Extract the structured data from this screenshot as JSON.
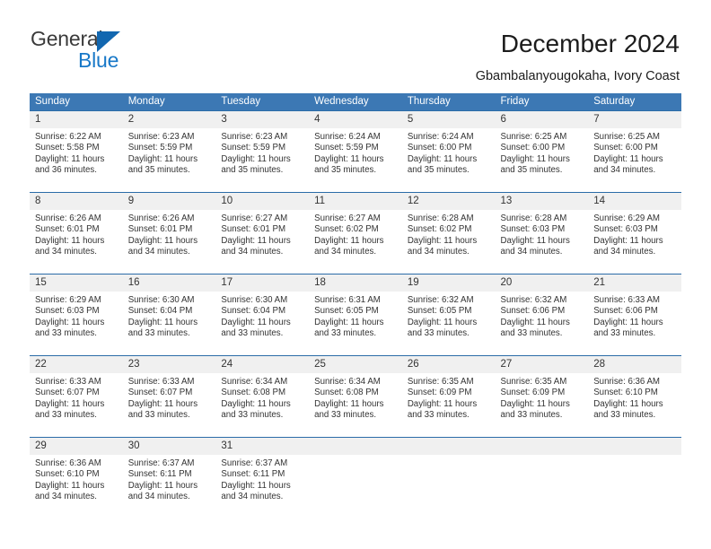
{
  "brand": {
    "name_part1": "General",
    "name_part2": "Blue"
  },
  "header": {
    "title": "December 2024",
    "subtitle": "Gbambalanyougokaha, Ivory Coast"
  },
  "colors": {
    "header_blue": "#3c78b4",
    "week_rule": "#2b6ca8",
    "date_band": "#f0f0f0",
    "brand_blue": "#1878c8",
    "text": "#333333"
  },
  "weekdays": [
    "Sunday",
    "Monday",
    "Tuesday",
    "Wednesday",
    "Thursday",
    "Friday",
    "Saturday"
  ],
  "weeks": [
    {
      "dates": [
        "1",
        "2",
        "3",
        "4",
        "5",
        "6",
        "7"
      ],
      "cells": [
        {
          "sunrise": "Sunrise: 6:22 AM",
          "sunset": "Sunset: 5:58 PM",
          "daylight1": "Daylight: 11 hours",
          "daylight2": "and 36 minutes."
        },
        {
          "sunrise": "Sunrise: 6:23 AM",
          "sunset": "Sunset: 5:59 PM",
          "daylight1": "Daylight: 11 hours",
          "daylight2": "and 35 minutes."
        },
        {
          "sunrise": "Sunrise: 6:23 AM",
          "sunset": "Sunset: 5:59 PM",
          "daylight1": "Daylight: 11 hours",
          "daylight2": "and 35 minutes."
        },
        {
          "sunrise": "Sunrise: 6:24 AM",
          "sunset": "Sunset: 5:59 PM",
          "daylight1": "Daylight: 11 hours",
          "daylight2": "and 35 minutes."
        },
        {
          "sunrise": "Sunrise: 6:24 AM",
          "sunset": "Sunset: 6:00 PM",
          "daylight1": "Daylight: 11 hours",
          "daylight2": "and 35 minutes."
        },
        {
          "sunrise": "Sunrise: 6:25 AM",
          "sunset": "Sunset: 6:00 PM",
          "daylight1": "Daylight: 11 hours",
          "daylight2": "and 35 minutes."
        },
        {
          "sunrise": "Sunrise: 6:25 AM",
          "sunset": "Sunset: 6:00 PM",
          "daylight1": "Daylight: 11 hours",
          "daylight2": "and 34 minutes."
        }
      ]
    },
    {
      "dates": [
        "8",
        "9",
        "10",
        "11",
        "12",
        "13",
        "14"
      ],
      "cells": [
        {
          "sunrise": "Sunrise: 6:26 AM",
          "sunset": "Sunset: 6:01 PM",
          "daylight1": "Daylight: 11 hours",
          "daylight2": "and 34 minutes."
        },
        {
          "sunrise": "Sunrise: 6:26 AM",
          "sunset": "Sunset: 6:01 PM",
          "daylight1": "Daylight: 11 hours",
          "daylight2": "and 34 minutes."
        },
        {
          "sunrise": "Sunrise: 6:27 AM",
          "sunset": "Sunset: 6:01 PM",
          "daylight1": "Daylight: 11 hours",
          "daylight2": "and 34 minutes."
        },
        {
          "sunrise": "Sunrise: 6:27 AM",
          "sunset": "Sunset: 6:02 PM",
          "daylight1": "Daylight: 11 hours",
          "daylight2": "and 34 minutes."
        },
        {
          "sunrise": "Sunrise: 6:28 AM",
          "sunset": "Sunset: 6:02 PM",
          "daylight1": "Daylight: 11 hours",
          "daylight2": "and 34 minutes."
        },
        {
          "sunrise": "Sunrise: 6:28 AM",
          "sunset": "Sunset: 6:03 PM",
          "daylight1": "Daylight: 11 hours",
          "daylight2": "and 34 minutes."
        },
        {
          "sunrise": "Sunrise: 6:29 AM",
          "sunset": "Sunset: 6:03 PM",
          "daylight1": "Daylight: 11 hours",
          "daylight2": "and 34 minutes."
        }
      ]
    },
    {
      "dates": [
        "15",
        "16",
        "17",
        "18",
        "19",
        "20",
        "21"
      ],
      "cells": [
        {
          "sunrise": "Sunrise: 6:29 AM",
          "sunset": "Sunset: 6:03 PM",
          "daylight1": "Daylight: 11 hours",
          "daylight2": "and 33 minutes."
        },
        {
          "sunrise": "Sunrise: 6:30 AM",
          "sunset": "Sunset: 6:04 PM",
          "daylight1": "Daylight: 11 hours",
          "daylight2": "and 33 minutes."
        },
        {
          "sunrise": "Sunrise: 6:30 AM",
          "sunset": "Sunset: 6:04 PM",
          "daylight1": "Daylight: 11 hours",
          "daylight2": "and 33 minutes."
        },
        {
          "sunrise": "Sunrise: 6:31 AM",
          "sunset": "Sunset: 6:05 PM",
          "daylight1": "Daylight: 11 hours",
          "daylight2": "and 33 minutes."
        },
        {
          "sunrise": "Sunrise: 6:32 AM",
          "sunset": "Sunset: 6:05 PM",
          "daylight1": "Daylight: 11 hours",
          "daylight2": "and 33 minutes."
        },
        {
          "sunrise": "Sunrise: 6:32 AM",
          "sunset": "Sunset: 6:06 PM",
          "daylight1": "Daylight: 11 hours",
          "daylight2": "and 33 minutes."
        },
        {
          "sunrise": "Sunrise: 6:33 AM",
          "sunset": "Sunset: 6:06 PM",
          "daylight1": "Daylight: 11 hours",
          "daylight2": "and 33 minutes."
        }
      ]
    },
    {
      "dates": [
        "22",
        "23",
        "24",
        "25",
        "26",
        "27",
        "28"
      ],
      "cells": [
        {
          "sunrise": "Sunrise: 6:33 AM",
          "sunset": "Sunset: 6:07 PM",
          "daylight1": "Daylight: 11 hours",
          "daylight2": "and 33 minutes."
        },
        {
          "sunrise": "Sunrise: 6:33 AM",
          "sunset": "Sunset: 6:07 PM",
          "daylight1": "Daylight: 11 hours",
          "daylight2": "and 33 minutes."
        },
        {
          "sunrise": "Sunrise: 6:34 AM",
          "sunset": "Sunset: 6:08 PM",
          "daylight1": "Daylight: 11 hours",
          "daylight2": "and 33 minutes."
        },
        {
          "sunrise": "Sunrise: 6:34 AM",
          "sunset": "Sunset: 6:08 PM",
          "daylight1": "Daylight: 11 hours",
          "daylight2": "and 33 minutes."
        },
        {
          "sunrise": "Sunrise: 6:35 AM",
          "sunset": "Sunset: 6:09 PM",
          "daylight1": "Daylight: 11 hours",
          "daylight2": "and 33 minutes."
        },
        {
          "sunrise": "Sunrise: 6:35 AM",
          "sunset": "Sunset: 6:09 PM",
          "daylight1": "Daylight: 11 hours",
          "daylight2": "and 33 minutes."
        },
        {
          "sunrise": "Sunrise: 6:36 AM",
          "sunset": "Sunset: 6:10 PM",
          "daylight1": "Daylight: 11 hours",
          "daylight2": "and 33 minutes."
        }
      ]
    },
    {
      "dates": [
        "29",
        "30",
        "31",
        "",
        "",
        "",
        ""
      ],
      "cells": [
        {
          "sunrise": "Sunrise: 6:36 AM",
          "sunset": "Sunset: 6:10 PM",
          "daylight1": "Daylight: 11 hours",
          "daylight2": "and 34 minutes."
        },
        {
          "sunrise": "Sunrise: 6:37 AM",
          "sunset": "Sunset: 6:11 PM",
          "daylight1": "Daylight: 11 hours",
          "daylight2": "and 34 minutes."
        },
        {
          "sunrise": "Sunrise: 6:37 AM",
          "sunset": "Sunset: 6:11 PM",
          "daylight1": "Daylight: 11 hours",
          "daylight2": "and 34 minutes."
        },
        {
          "sunrise": "",
          "sunset": "",
          "daylight1": "",
          "daylight2": ""
        },
        {
          "sunrise": "",
          "sunset": "",
          "daylight1": "",
          "daylight2": ""
        },
        {
          "sunrise": "",
          "sunset": "",
          "daylight1": "",
          "daylight2": ""
        },
        {
          "sunrise": "",
          "sunset": "",
          "daylight1": "",
          "daylight2": ""
        }
      ]
    }
  ]
}
